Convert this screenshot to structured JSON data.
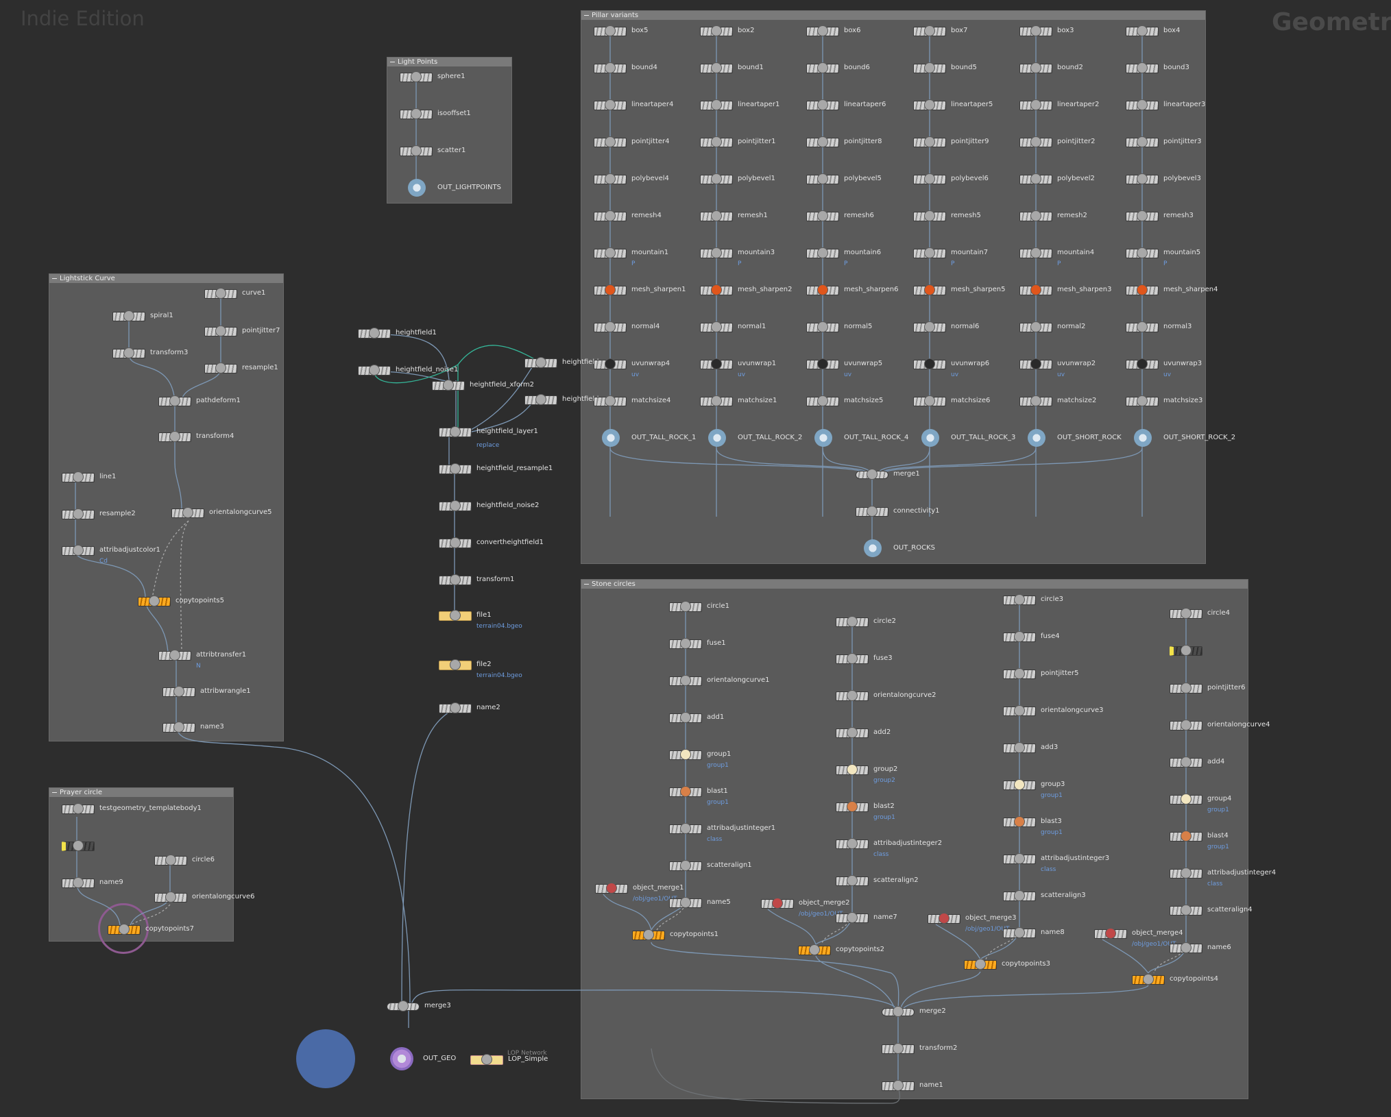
{
  "watermark": {
    "edition": "Indie Edition",
    "context": "Geometry"
  },
  "networkboxes": {
    "light_points": "Light Points",
    "lightstick_curve": "Lightstick Curve",
    "pillar_variants": "Pillar variants",
    "prayer_circle": "Prayer circle",
    "stone_circles": "Stone circles"
  },
  "colors": {
    "background": "#2d2d2d",
    "box": "#5a5a5a",
    "wire": "#7d98b5",
    "copy_node": "#ffab20",
    "file_node": "#f2cf78",
    "selected_halo": "#4a6aa6"
  },
  "nodes": {
    "sphere1": "sphere1",
    "isooffset1": "isooffset1",
    "scatter1": "scatter1",
    "out_lightpoints": "OUT_LIGHTPOINTS",
    "curve1": "curve1",
    "spiral1": "spiral1",
    "pointjitter7": "pointjitter7",
    "transform3": "transform3",
    "resample1": "resample1",
    "pathdeform1": "pathdeform1",
    "transform4": "transform4",
    "line1": "line1",
    "resample2": "resample2",
    "orientalongcurve5": "orientalongcurve5",
    "attribadjustcolor1": "attribadjustcolor1",
    "copytopoints5": "copytopoints5",
    "attribtransfer1": "attribtransfer1",
    "attribwrangle1": "attribwrangle1",
    "name3": "name3",
    "testgeometry": "testgeometry_templatebody1",
    "circle6": "circle6",
    "name9": "name9",
    "orientalongcurve6": "orientalongcurve6",
    "copytopoints7": "copytopoints7",
    "heightfield1": "heightfield1",
    "heightfield_noise1": "heightfield_noise1",
    "heightfield_xform2": "heightfield_xform2",
    "heightfield_a": "heightfield",
    "heightfield_b": "heightfield",
    "heightfield_layer1": "heightfield_layer1",
    "heightfield_resample1": "heightfield_resample1",
    "heightfield_noise2": "heightfield_noise2",
    "convertheightfield1": "convertheightfield1",
    "transform1": "transform1",
    "file1": "file1",
    "file2": "file2",
    "name2": "name2",
    "merge3": "merge3",
    "out_geo": "OUT_GEO",
    "lop_simple": "LOP_Simple",
    "box5": "box5",
    "box2": "box2",
    "box6": "box6",
    "box7": "box7",
    "box3": "box3",
    "box4": "box4",
    "bound4": "bound4",
    "bound1": "bound1",
    "bound6": "bound6",
    "bound5": "bound5",
    "bound2": "bound2",
    "bound3": "bound3",
    "lineartaper4": "lineartaper4",
    "lineartaper1": "lineartaper1",
    "lineartaper6": "lineartaper6",
    "lineartaper5": "lineartaper5",
    "lineartaper2": "lineartaper2",
    "lineartaper3": "lineartaper3",
    "pointjitter4": "pointjitter4",
    "pointjitter1": "pointjitter1",
    "pointjitter8": "pointjitter8",
    "pointjitter9": "pointjitter9",
    "pointjitter2": "pointjitter2",
    "pointjitter3": "pointjitter3",
    "polybevel4": "polybevel4",
    "polybevel1": "polybevel1",
    "polybevel5": "polybevel5",
    "polybevel6": "polybevel6",
    "polybevel2": "polybevel2",
    "polybevel3": "polybevel3",
    "remesh4": "remesh4",
    "remesh1": "remesh1",
    "remesh6": "remesh6",
    "remesh5": "remesh5",
    "remesh2": "remesh2",
    "remesh3": "remesh3",
    "mountain1": "mountain1",
    "mountain3": "mountain3",
    "mountain6": "mountain6",
    "mountain7": "mountain7",
    "mountain4": "mountain4",
    "mountain5": "mountain5",
    "mesh_sharpen1": "mesh_sharpen1",
    "mesh_sharpen2": "mesh_sharpen2",
    "mesh_sharpen6": "mesh_sharpen6",
    "mesh_sharpen5": "mesh_sharpen5",
    "mesh_sharpen3": "mesh_sharpen3",
    "mesh_sharpen4": "mesh_sharpen4",
    "normal4": "normal4",
    "normal1": "normal1",
    "normal5": "normal5",
    "normal6": "normal6",
    "normal2": "normal2",
    "normal3": "normal3",
    "uvunwrap4": "uvunwrap4",
    "uvunwrap1": "uvunwrap1",
    "uvunwrap5": "uvunwrap5",
    "uvunwrap6": "uvunwrap6",
    "uvunwrap2": "uvunwrap2",
    "uvunwrap3": "uvunwrap3",
    "matchsize4": "matchsize4",
    "matchsize1": "matchsize1",
    "matchsize5": "matchsize5",
    "matchsize6": "matchsize6",
    "matchsize2": "matchsize2",
    "matchsize3": "matchsize3",
    "out_tall_rock_1": "OUT_TALL_ROCK_1",
    "out_tall_rock_2": "OUT_TALL_ROCK_2",
    "out_tall_rock_4": "OUT_TALL_ROCK_4",
    "out_tall_rock_3": "OUT_TALL_ROCK_3",
    "out_short_rock": "OUT_SHORT_ROCK",
    "out_short_rock_2": "OUT_SHORT_ROCK_2",
    "merge1": "merge1",
    "connectivity1": "connectivity1",
    "out_rocks": "OUT_ROCKS",
    "circle1": "circle1",
    "fuse1": "fuse1",
    "orientalongcurve1": "orientalongcurve1",
    "add1": "add1",
    "group1": "group1",
    "blast1": "blast1",
    "attribadjustinteger1": "attribadjustinteger1",
    "scatteralign1": "scatteralign1",
    "object_merge1": "object_merge1",
    "name5": "name5",
    "copytopoints1": "copytopoints1",
    "circle2": "circle2",
    "fuse3": "fuse3",
    "orientalongcurve2": "orientalongcurve2",
    "add2": "add2",
    "group2": "group2",
    "blast2": "blast2",
    "attribadjustinteger2": "attribadjustinteger2",
    "scatteralign2": "scatteralign2",
    "object_merge2": "object_merge2",
    "name7": "name7",
    "copytopoints2": "copytopoints2",
    "circle3": "circle3",
    "fuse4": "fuse4",
    "pointjitter5": "pointjitter5",
    "orientalongcurve3": "orientalongcurve3",
    "add3": "add3",
    "group3": "group3",
    "blast3": "blast3",
    "attribadjustinteger3": "attribadjustinteger3",
    "scatteralign3": "scatteralign3",
    "object_merge3": "object_merge3",
    "name8": "name8",
    "copytopoints3": "copytopoints3",
    "circle4": "circle4",
    "pointjitter6": "pointjitter6",
    "orientalongcurve4": "orientalongcurve4",
    "add4": "add4",
    "group4": "group4",
    "blast4": "blast4",
    "attribadjustinteger4": "attribadjustinteger4",
    "scatteralign4": "scatteralign4",
    "object_merge4": "object_merge4",
    "name6": "name6",
    "copytopoints4": "copytopoints4",
    "merge2": "merge2",
    "transform2": "transform2",
    "name1": "name1"
  },
  "badges": {
    "cd": "Cd",
    "n": "N",
    "replace": "replace",
    "terrain04": "terrain04.bgeo",
    "p": "P",
    "uv": "uv",
    "group1": "group1",
    "group2": "group2",
    "group3": "group3",
    "class": "class",
    "obj_path1": "/obj/geo1/OUT_...",
    "obj_path2": "/obj/geo1/OUT_...",
    "obj_path3": "/obj/geo1/OUT_...",
    "obj_path4": "/obj/geo1/OUT_...",
    "lop_network": "LOP Network"
  }
}
